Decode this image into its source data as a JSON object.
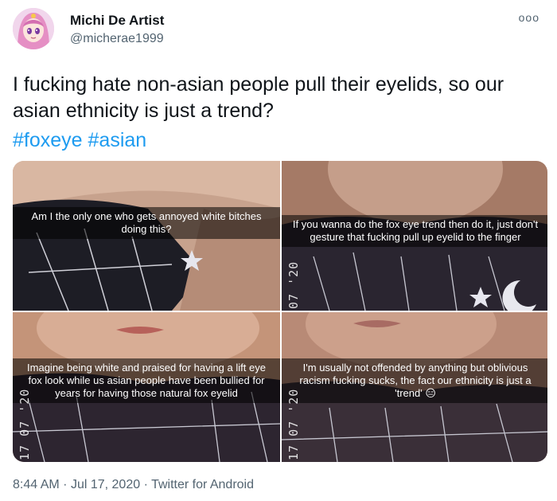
{
  "author": {
    "display_name": "Michi De Artist",
    "handle": "@micherae1999",
    "avatar_icon": "anime-girl-avatar"
  },
  "more_icon": "ooo",
  "tweet": {
    "text": "I fucking hate non-asian people pull their eyelids, so our asian ethnicity is just a trend?",
    "hashtags": [
      "#foxeye",
      "#asian"
    ]
  },
  "media": [
    {
      "caption": "Am I the only one who gets annoyed white bitches doing this?",
      "stamp": ""
    },
    {
      "caption": "If you wanna do the fox eye trend then do it, just don't gesture that fucking pull up eyelid to the finger",
      "stamp": "07 '20"
    },
    {
      "caption": "Imagine being white and praised for having a lift eye fox look while us asian people have been bullied for years for having those natural fox eyelid",
      "stamp": "17 07 '20"
    },
    {
      "caption": "I'm usually not offended by anything but oblivious racism fucking sucks, the fact our ethnicity is just a 'trend' 😑",
      "stamp": "17 07 '20"
    }
  ],
  "footer": {
    "time": "8:44 AM",
    "separator": "·",
    "date": "Jul 17, 2020",
    "source": "Twitter for Android"
  },
  "colors": {
    "link": "#1d9bf0",
    "secondary_text": "#536471",
    "primary_text": "#0f1419"
  }
}
